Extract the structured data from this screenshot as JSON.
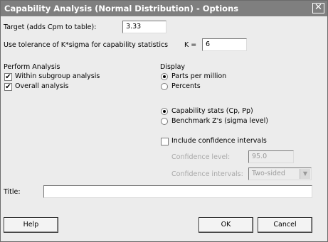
{
  "window": {
    "title": "Capability Analysis (Normal Distribution) - Options",
    "close_glyph": "✕"
  },
  "target": {
    "label": "Target (adds Cpm to table):",
    "value": "3.33"
  },
  "tolerance": {
    "label": "Use tolerance of K*sigma for capability statistics",
    "k_label": "K =",
    "k_value": "6"
  },
  "perform_analysis": {
    "heading": "Perform Analysis",
    "within": {
      "label": "Within subgroup analysis",
      "checked": true
    },
    "overall": {
      "label": "Overall analysis",
      "checked": true
    }
  },
  "display": {
    "heading": "Display",
    "units": {
      "ppm": "Parts per million",
      "percents": "Percents",
      "selected": "ppm"
    },
    "stats": {
      "capability": "Capability stats (Cp, Pp)",
      "benchmark": "Benchmark Z's (sigma level)",
      "selected": "capability"
    },
    "confidence": {
      "include_label": "Include confidence intervals",
      "include_checked": false,
      "level_label": "Confidence level:",
      "level_value": "95.0",
      "intervals_label": "Confidence intervals:",
      "intervals_value": "Two-sided"
    }
  },
  "title_field": {
    "label": "Title:",
    "value": ""
  },
  "buttons": {
    "help": "Help",
    "ok": "OK",
    "cancel": "Cancel"
  },
  "icons": {
    "checkmark": "✔",
    "dropdown": "▼"
  }
}
